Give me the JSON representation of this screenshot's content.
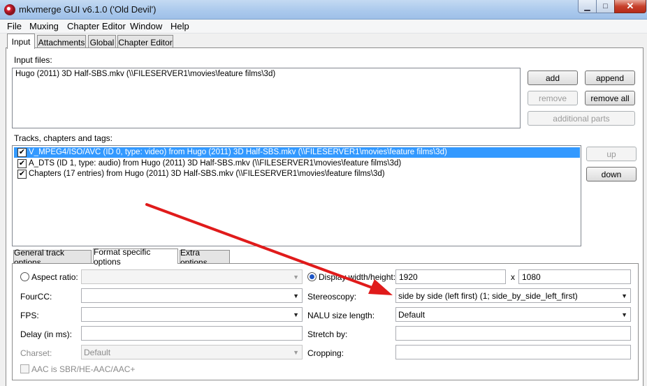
{
  "window": {
    "title": "mkvmerge GUI v6.1.0 ('Old Devil')",
    "min_glyph": "▁",
    "max_glyph": "□",
    "close_glyph": "✕"
  },
  "menu": [
    "File",
    "Muxing",
    "Chapter Editor",
    "Window",
    "Help"
  ],
  "main_tabs": [
    "Input",
    "Attachments",
    "Global",
    "Chapter Editor"
  ],
  "input": {
    "files_label": "Input files:",
    "files": [
      "Hugo (2011) 3D Half-SBS.mkv (\\\\FILESERVER1\\movies\\feature films\\3d)"
    ],
    "buttons": {
      "add": "add",
      "append": "append",
      "remove": "remove",
      "remove_all": "remove all",
      "additional_parts": "additional parts"
    },
    "tracks_label": "Tracks, chapters and tags:",
    "tracks": [
      "V_MPEG4/ISO/AVC (ID 0, type: video) from Hugo (2011) 3D Half-SBS.mkv (\\\\FILESERVER1\\movies\\feature films\\3d)",
      "A_DTS (ID 1, type: audio) from Hugo (2011) 3D Half-SBS.mkv (\\\\FILESERVER1\\movies\\feature films\\3d)",
      "Chapters (17 entries) from Hugo (2011) 3D Half-SBS.mkv (\\\\FILESERVER1\\movies\\feature films\\3d)"
    ],
    "track_buttons": {
      "up": "up",
      "down": "down"
    },
    "check_glyph": "✔"
  },
  "sub_tabs": [
    "General track options",
    "Format specific options",
    "Extra options"
  ],
  "format": {
    "aspect_ratio_label": "Aspect ratio:",
    "aspect_ratio_value": "",
    "fourcc_label": "FourCC:",
    "fourcc_value": "",
    "fps_label": "FPS:",
    "fps_value": "",
    "delay_label": "Delay (in ms):",
    "delay_value": "",
    "charset_label": "Charset:",
    "charset_value": "Default",
    "aac_label": "AAC is SBR/HE-AAC/AAC+",
    "display_wh_label": "Display width/height:",
    "display_width": "1920",
    "display_x": "x",
    "display_height": "1080",
    "stereoscopy_label": "Stereoscopy:",
    "stereoscopy_value": "side by side (left first) (1; side_by_side_left_first)",
    "nalu_label": "NALU size length:",
    "nalu_value": "Default",
    "stretch_label": "Stretch by:",
    "stretch_value": "",
    "cropping_label": "Cropping:",
    "cropping_value": ""
  },
  "arrow_glyph": "▼",
  "annotation_color": "#e01b1b",
  "selection_color": "#3399ff"
}
